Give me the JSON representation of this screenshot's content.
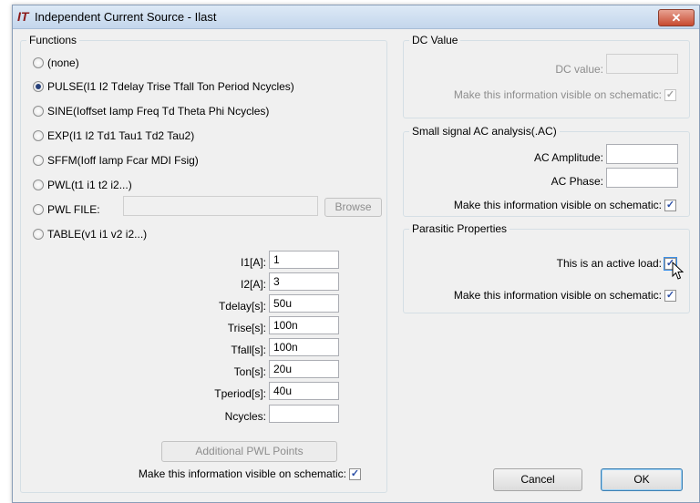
{
  "window": {
    "title": "Independent Current Source - Ilast",
    "close_glyph": "✕",
    "app_icon": "ltspice-icon",
    "icon_glyph": "IT"
  },
  "functions": {
    "title": "Functions",
    "options": [
      {
        "label": "(none)",
        "selected": false
      },
      {
        "label": "PULSE(I1 I2 Tdelay Trise Tfall Ton Period Ncycles)",
        "selected": true
      },
      {
        "label": "SINE(Ioffset Iamp Freq Td Theta Phi Ncycles)",
        "selected": false
      },
      {
        "label": "EXP(I1 I2 Td1 Tau1 Td2 Tau2)",
        "selected": false
      },
      {
        "label": "SFFM(Ioff Iamp Fcar MDI Fsig)",
        "selected": false
      },
      {
        "label": "PWL(t1 i1 t2 i2...)",
        "selected": false
      },
      {
        "label": "PWL FILE:",
        "selected": false
      },
      {
        "label": "TABLE(v1 i1 v2 i2...)",
        "selected": false
      }
    ],
    "pwl_file_value": "",
    "browse_label": "Browse",
    "params": [
      {
        "label": "I1[A]:",
        "value": "1"
      },
      {
        "label": "I2[A]:",
        "value": "3"
      },
      {
        "label": "Tdelay[s]:",
        "value": "50u"
      },
      {
        "label": "Trise[s]:",
        "value": "100n"
      },
      {
        "label": "Tfall[s]:",
        "value": "100n"
      },
      {
        "label": "Ton[s]:",
        "value": "20u"
      },
      {
        "label": "Tperiod[s]:",
        "value": "40u"
      },
      {
        "label": "Ncycles:",
        "value": ""
      }
    ],
    "additional_pwl_label": "Additional PWL Points",
    "visible_label": "Make this information visible on schematic:",
    "visible_checked": true
  },
  "dc": {
    "title": "DC Value",
    "value_label": "DC value:",
    "value": "",
    "visible_label": "Make this information visible on schematic:",
    "visible_checked": true
  },
  "ac": {
    "title": "Small signal AC analysis(.AC)",
    "amplitude_label": "AC Amplitude:",
    "amplitude": "",
    "phase_label": "AC Phase:",
    "phase": "",
    "visible_label": "Make this information visible on schematic:",
    "visible_checked": true
  },
  "parasitic": {
    "title": "Parasitic Properties",
    "active_load_label": "This is an active load:",
    "active_load_checked": true,
    "visible_label": "Make this information visible on schematic:",
    "visible_checked": true
  },
  "buttons": {
    "cancel": "Cancel",
    "ok": "OK"
  },
  "check_glyph": "✓"
}
